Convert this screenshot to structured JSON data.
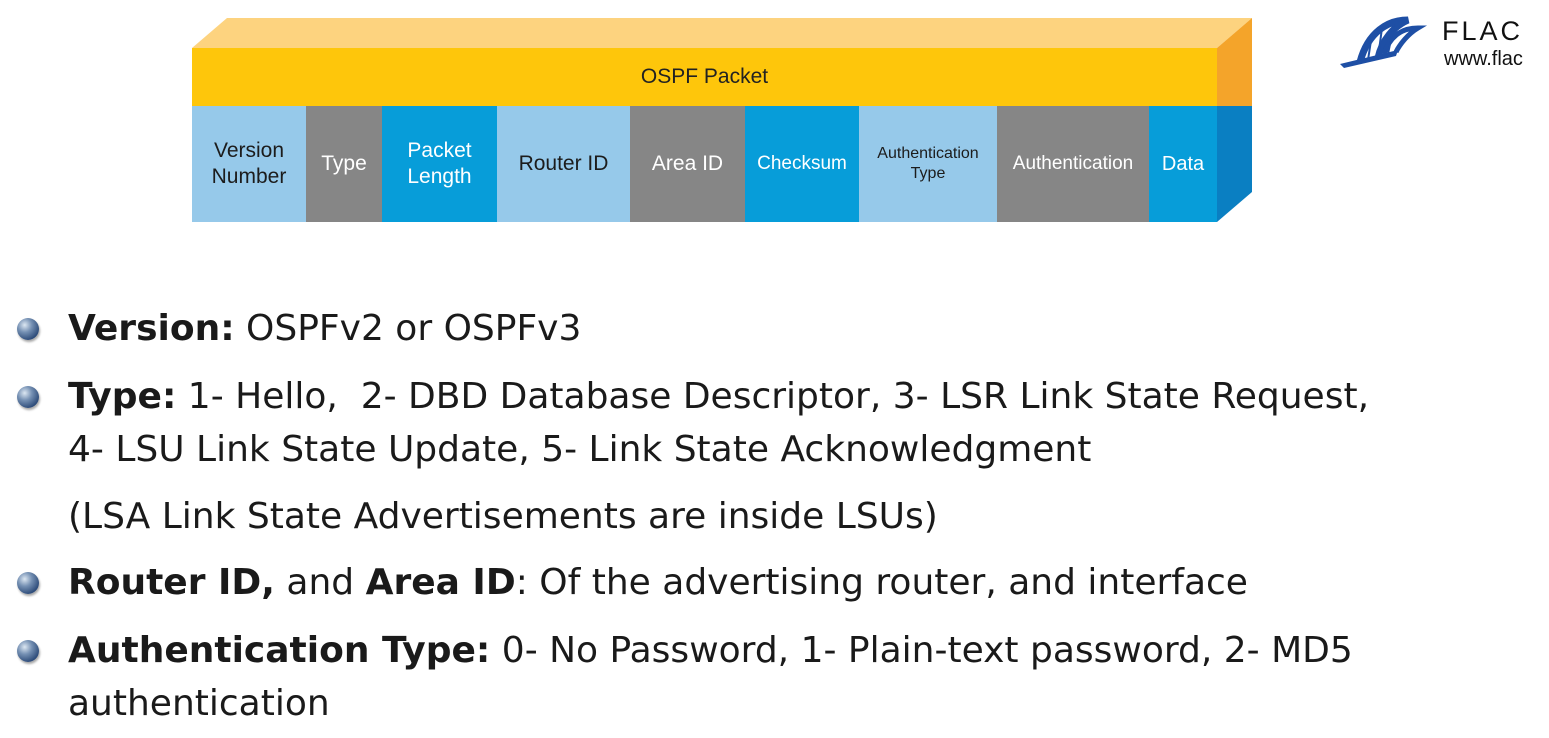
{
  "diagram": {
    "title": "OSPF Packet",
    "fields": [
      {
        "label": "Version\nNumber",
        "style": "light",
        "size": "f-xl",
        "width": 114
      },
      {
        "label": "Type",
        "style": "gray",
        "size": "f-xl",
        "width": 76
      },
      {
        "label": "Packet\nLength",
        "style": "blue",
        "size": "f-xl",
        "width": 115
      },
      {
        "label": "Router ID",
        "style": "light",
        "size": "f-xl",
        "width": 133
      },
      {
        "label": "Area ID",
        "style": "gray",
        "size": "f-xl",
        "width": 115
      },
      {
        "label": "Checksum",
        "style": "blue",
        "size": "f-m",
        "width": 114
      },
      {
        "label": "Authentication\nType",
        "style": "light",
        "size": "f-s",
        "width": 138
      },
      {
        "label": "Authentication",
        "style": "gray",
        "size": "f-m",
        "width": 152
      },
      {
        "label": "Data",
        "style": "blue",
        "size": "f-l",
        "width": 68
      }
    ],
    "colors": {
      "top_face": "#fdd37f",
      "band": "#fec60b",
      "light": "#96c9ea",
      "gray": "#868686",
      "blue": "#079dd9"
    }
  },
  "logo": {
    "name": "FLAC",
    "url": "www.flac",
    "icon": "bridge-logo-icon"
  },
  "bullets": {
    "version": {
      "label": "Version:",
      "text": " OSPFv2 or OSPFv3"
    },
    "type": {
      "label": "Type:",
      "line1": " 1- Hello,  2- DBD Database Descriptor, 3- LSR Link State Request,",
      "line2": "4- LSU Link State Update, 5- Link State Acknowledgment"
    },
    "lsa_note": "(LSA Link State Advertisements are inside LSUs)",
    "router": {
      "label1": "Router ID,",
      "mid": " and ",
      "label2": "Area ID",
      "text": ": Of the advertising router, and interface"
    },
    "auth": {
      "label": "Authentication Type:",
      "line1": " 0- No Password, 1- Plain-text password, 2- MD5",
      "line2": "authentication"
    }
  }
}
